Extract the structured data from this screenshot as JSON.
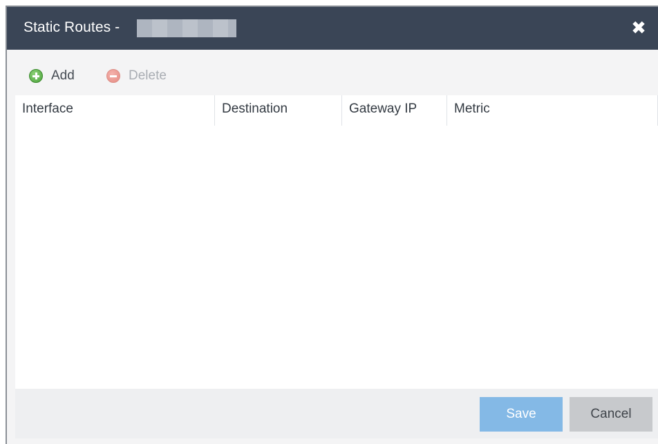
{
  "dialog": {
    "title": "Static Routes -",
    "close_icon": "close-icon"
  },
  "toolbar": {
    "add_label": "Add",
    "add_icon": "add-circle-icon",
    "delete_label": "Delete",
    "delete_icon": "remove-circle-icon"
  },
  "grid": {
    "columns": [
      "Interface",
      "Destination",
      "Gateway IP",
      "Metric"
    ],
    "rows": []
  },
  "footer": {
    "save_label": "Save",
    "cancel_label": "Cancel"
  },
  "colors": {
    "titlebar": "#3a4556",
    "save_button": "#84b9e6",
    "cancel_button": "#c7c9cc",
    "add_icon": "#4aa23a",
    "delete_icon": "#e48a82"
  }
}
